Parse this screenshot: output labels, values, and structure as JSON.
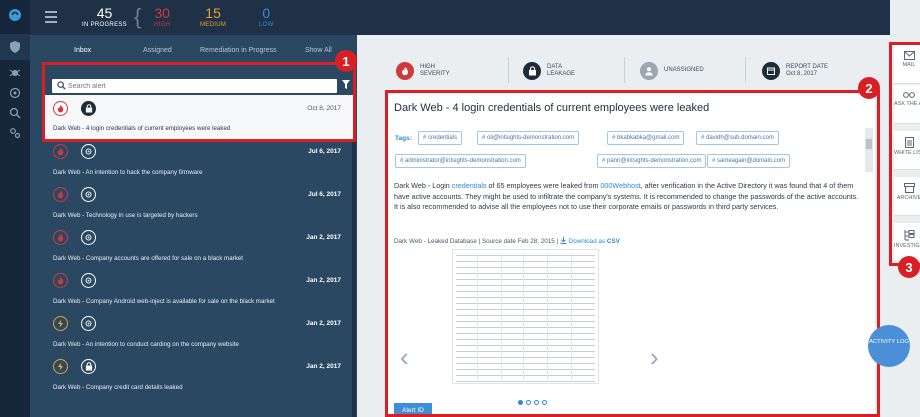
{
  "topbar": {
    "in_progress": {
      "value": "45",
      "label": "IN PROGRESS"
    },
    "high": {
      "value": "30",
      "label": "HIGH"
    },
    "medium": {
      "value": "15",
      "label": "MEDIUM"
    },
    "low": {
      "value": "0",
      "label": "LOW"
    }
  },
  "colors": {
    "high": "#d0393b",
    "medium": "#e7a327",
    "low": "#3b8ad0",
    "accent": "#2a8bd6",
    "highlight": "#d81f26"
  },
  "inbox": {
    "tabs": [
      "Inbox",
      "Assigned",
      "Remediation in Progress",
      "Show All"
    ],
    "search_placeholder": "Search alert",
    "alerts": [
      {
        "date": "Oct 8, 2017",
        "title": "Dark Web - 4 login credentials of current employees were leaked",
        "icon1": "flame-icon",
        "icon2": "lock-icon"
      },
      {
        "date": "Jul 6, 2017",
        "title": "Dark Web - An intention to hack the company firmware",
        "icon1": "flame-icon",
        "icon2": "crosshair-icon"
      },
      {
        "date": "Jul 6, 2017",
        "title": "Dark Web - Technology in use is targeted by hackers",
        "icon1": "flame-icon",
        "icon2": "crosshair-icon"
      },
      {
        "date": "Jan 2, 2017",
        "title": "Dark Web - Company accounts are offered for sale on a black market",
        "icon1": "flame-icon",
        "icon2": "crosshair-icon"
      },
      {
        "date": "Jan 2, 2017",
        "title": "Dark Web - Company Android web-inject is available for sale on the black market",
        "icon1": "flame-icon",
        "icon2": "crosshair-icon"
      },
      {
        "date": "Jan 2, 2017",
        "title": "Dark Web - An intention to conduct carding on the company website",
        "icon1": "bolt-icon",
        "icon2": "crosshair-icon"
      },
      {
        "date": "Jan 2, 2017",
        "title": "Dark Web - Company credit card details leaked",
        "icon1": "bolt-icon",
        "icon2": "lock-icon"
      }
    ]
  },
  "detail": {
    "severity_label": "HIGH",
    "severity_sub": "SEVERITY",
    "type_label": "DATA",
    "type_sub": "LEAKAGE",
    "assignee": "UNASSIGNED",
    "report_date_label": "REPORT DATE",
    "report_date": "Oct 8, 2017",
    "title": "Dark Web - 4 login credentials of current employees were leaked",
    "tags_label": "Tags:",
    "tags": [
      "# credentials",
      "# oli@intsights-demonstration.com",
      "# bkabkabka@gmail.com",
      "# davidh@sub.domain.com",
      "# administrator@intsights-demonstration.com",
      "# pann@intsights-demonstration.com",
      "# sameagain@domain.com"
    ],
    "desc_prefix": "Dark Web - Login ",
    "desc_link1": "credentials",
    "desc_mid": " of 65 employees were leaked from ",
    "desc_link2": "000Webhost",
    "desc_rest": ", after verification in the Active Directory it was found that 4 of them have active accounts. They might be used to infiltrate the company's systems. It is recommended to change the passwords of the active accounts. It is also recommended to advise all the employees not to use their corporate emails or passwords in third party services.",
    "source_text": "Dark Web - Leaked Database  |  Source date Feb 28, 2015  |",
    "download_text": "Download as",
    "download_format": "CSV",
    "alert_id_label": "Alert ID"
  },
  "right_panel": {
    "buttons": [
      "MAIL",
      "ASK THE ANALYST",
      "WHITE LIST",
      "ARCHIVE",
      "INVESTIGATE"
    ],
    "activity_log": "ACTIVITY LOG"
  },
  "annotations": [
    "1",
    "2",
    "3"
  ]
}
